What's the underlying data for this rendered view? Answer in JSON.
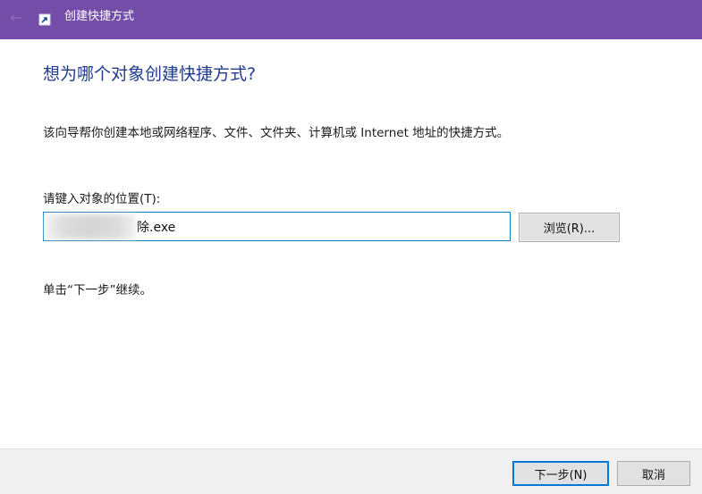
{
  "window": {
    "title": "创建快捷方式",
    "accent_color": "#744da9"
  },
  "icons": {
    "back": "arrow-left-icon",
    "app": "shortcut-icon"
  },
  "content": {
    "heading": "想为哪个对象创建快捷方式?",
    "description": "该向导帮你创建本地或网络程序、文件、文件夹、计算机或 Internet 地址的快捷方式。",
    "location_label": "请键入对象的位置(T):",
    "location_value": "除.exe",
    "browse_label": "浏览(R)...",
    "hint": "单击“下一步”继续。"
  },
  "footer": {
    "next_label": "下一步(N)",
    "cancel_label": "取消"
  }
}
